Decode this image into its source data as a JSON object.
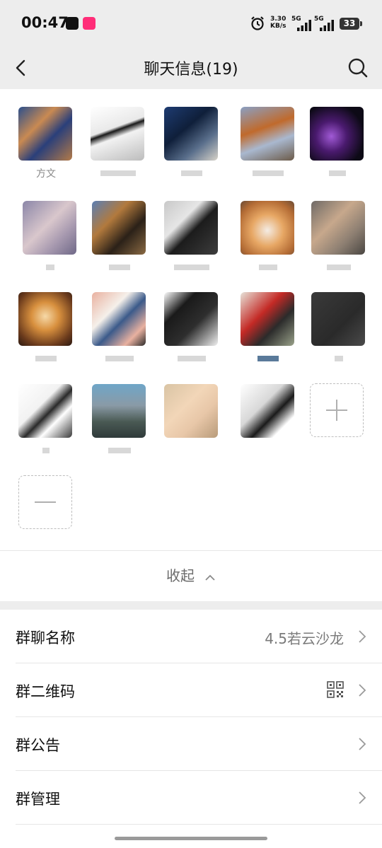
{
  "status_bar": {
    "time": "00:47",
    "net_speed_value": "3.30",
    "net_speed_unit": "KB/s",
    "signal1_label": "5G",
    "signal2_label": "5G",
    "battery": "33"
  },
  "header": {
    "title": "聊天信息(19)"
  },
  "members": {
    "first_name": "方文"
  },
  "collapse": {
    "label": "收起"
  },
  "settings": {
    "group_name_label": "群聊名称",
    "group_name_value": "4.5若云沙龙",
    "qr_label": "群二维码",
    "announcement_label": "群公告",
    "manage_label": "群管理"
  },
  "colors": {
    "header_bg": "#ededed",
    "text": "#111111",
    "muted": "#7a7a7a"
  }
}
